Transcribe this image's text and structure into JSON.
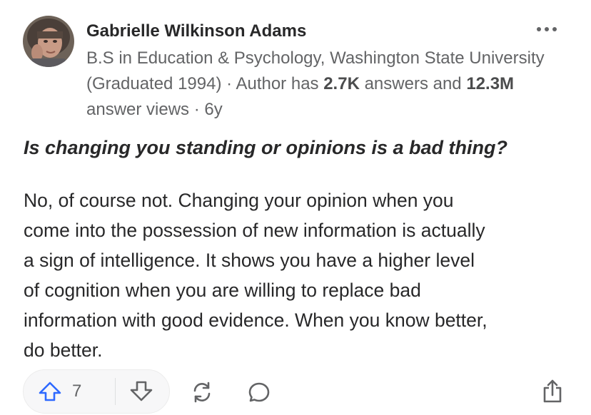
{
  "author": {
    "name": "Gabrielle Wilkinson Adams",
    "credential_prefix": "B.S in Education & Psychology, Washington State University (Graduated 1994) · Author has ",
    "answers_count": "2.7K",
    "answers_suffix": " answers and ",
    "views_count": "12.3M",
    "views_suffix": " answer views · 6y"
  },
  "question": "Is changing you standing or opinions is a bad thing?",
  "answer_lines": [
    "No, of course not. Changing your opinion when you",
    "come into the possession of new information is actually",
    "a sign of intelligence. It shows you have a higher level",
    "of cognition when you are willing to replace bad",
    "information with good evidence. When you know better,",
    "do better."
  ],
  "actions": {
    "upvote_count": "7"
  },
  "colors": {
    "upvote_blue": "#2e69ff",
    "icon_gray": "#636466",
    "text_primary": "#282829",
    "text_secondary": "#636466"
  },
  "icons": {
    "more": "more-horizontal-icon",
    "upvote": "arrow-up-icon",
    "downvote": "arrow-down-icon",
    "share": "refresh-share-icon",
    "comment": "speech-bubble-icon",
    "export": "share-export-icon"
  }
}
